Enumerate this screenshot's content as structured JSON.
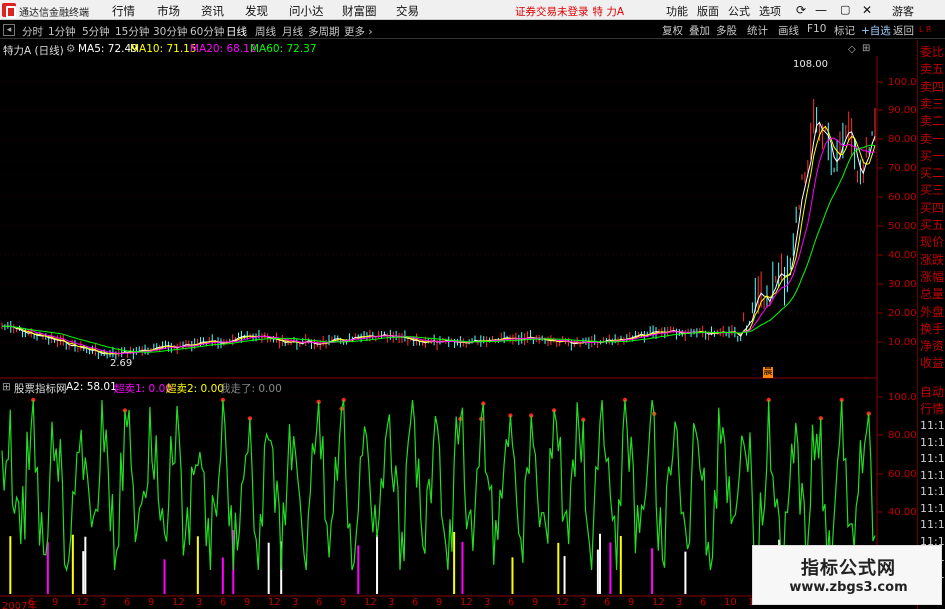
{
  "app": {
    "name": "通达信金融终端",
    "menu": [
      "行情",
      "市场",
      "资讯",
      "发现",
      "问小达",
      "财富圈",
      "交易"
    ],
    "login_notice": "证券交易未登录",
    "stock_title": "特 力A",
    "right_menu": [
      "功能",
      "版面",
      "公式",
      "选项"
    ],
    "guest_label": "游客",
    "window_controls": [
      "sync-icon",
      "minimize-icon",
      "maximize-icon",
      "close-icon"
    ]
  },
  "toolbar": {
    "periods": [
      "分时",
      "1分钟",
      "5分钟",
      "15分钟",
      "30分钟",
      "60分钟",
      "日线",
      "周线",
      "月线",
      "多周期",
      "更多"
    ],
    "active_period": "日线",
    "right_buttons": [
      "复权",
      "叠加",
      "多股",
      "统计",
      "画线",
      "F10",
      "标记",
      "+自选",
      "返回"
    ],
    "top_right_tag": "L R"
  },
  "main_chart": {
    "stock": "特力A (日线)",
    "ma5": "MA5: 72.49",
    "ma10": "MA10: 71.15",
    "ma20": "MA20: 68.12",
    "ma60": "MA60: 72.37",
    "high_label": "108.00",
    "low_label": "2.69",
    "marker": "晨",
    "price_axis": [
      "100.00",
      "90.00",
      "80.00",
      "70.00",
      "60.00",
      "50.00",
      "40.00",
      "30.00",
      "20.00",
      "10.00"
    ],
    "colors": {
      "ma5": "#ffffff",
      "ma10": "#ffff00",
      "ma20": "#ff00ff",
      "ma60": "#00ff00",
      "axis": "#c00000",
      "up": "#ff3232",
      "down": "#54ffff"
    }
  },
  "indicator": {
    "name": "股票指标网",
    "a2": "A2: 58.01",
    "chaomai1": "超卖1: 0.00",
    "chaomai2": "超卖2: 0.00",
    "wozoule": "我走了: 0.00",
    "axis": [
      "100.00",
      "80.00",
      "60.00",
      "40.00"
    ]
  },
  "date_axis": [
    "2007年",
    "6",
    "9",
    "12",
    "3",
    "6",
    "9",
    "12",
    "3",
    "6",
    "9",
    "12",
    "3",
    "6",
    "9",
    "12",
    "3",
    "6",
    "9",
    "12",
    "3",
    "6",
    "9",
    "12",
    "3",
    "6",
    "9",
    "12",
    "3",
    "6",
    "10",
    "1",
    "4",
    "7",
    "10",
    "1"
  ],
  "right_panel": {
    "quote_labels": [
      "委比",
      "卖五",
      "卖四",
      "卖三",
      "卖二",
      "卖一",
      "买一",
      "买二",
      "买三",
      "买四",
      "买五",
      "现价",
      "涨跌",
      "涨幅",
      "总量",
      "外盘",
      "换手",
      "净资",
      "收益"
    ],
    "tabs": [
      "自动",
      "行情"
    ],
    "times": [
      "11:1",
      "11:1",
      "11:1",
      "11:1",
      "11:1",
      "11:1",
      "11:1",
      "11:1",
      "11:1",
      "11:1"
    ]
  },
  "watermark": {
    "title": "指标公式网",
    "url": "www.zbgs3.com"
  }
}
